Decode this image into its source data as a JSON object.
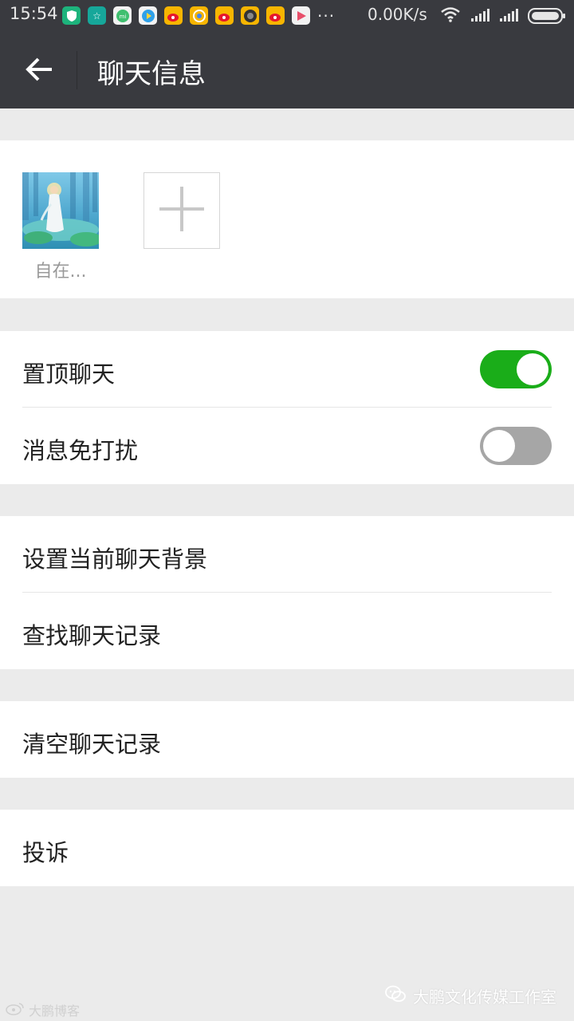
{
  "status_bar": {
    "time": "15:54",
    "network_speed": "0.00K/s",
    "more": "...",
    "app_icons": [
      "shield-app-icon",
      "star-app-icon",
      "mi-app-icon",
      "play-app-icon",
      "weibo-app-icon",
      "chrome-app-icon",
      "weibo-app-icon",
      "camera-app-icon",
      "weibo-app-icon",
      "playstore-app-icon"
    ],
    "indicators": [
      "wifi-icon",
      "signal-icon",
      "signal-icon",
      "battery-icon"
    ]
  },
  "header": {
    "back_icon": "arrow-left-icon",
    "title": "聊天信息"
  },
  "members": {
    "list": [
      {
        "name": "自在..."
      }
    ],
    "add_icon": "plus-icon"
  },
  "settings": {
    "pin_chat": {
      "label": "置顶聊天",
      "enabled": true
    },
    "mute": {
      "label": "消息免打扰",
      "enabled": false
    },
    "set_background": {
      "label": "设置当前聊天背景"
    },
    "search_history": {
      "label": "查找聊天记录"
    },
    "clear_history": {
      "label": "清空聊天记录"
    },
    "report": {
      "label": "投诉"
    }
  },
  "watermarks": {
    "left": "大鹏博客",
    "right": "大鹏文化传媒工作室"
  },
  "colors": {
    "header_bg": "#393a3f",
    "page_bg": "#ebebeb",
    "toggle_on": "#1aad19",
    "toggle_off": "#a6a6a6"
  }
}
